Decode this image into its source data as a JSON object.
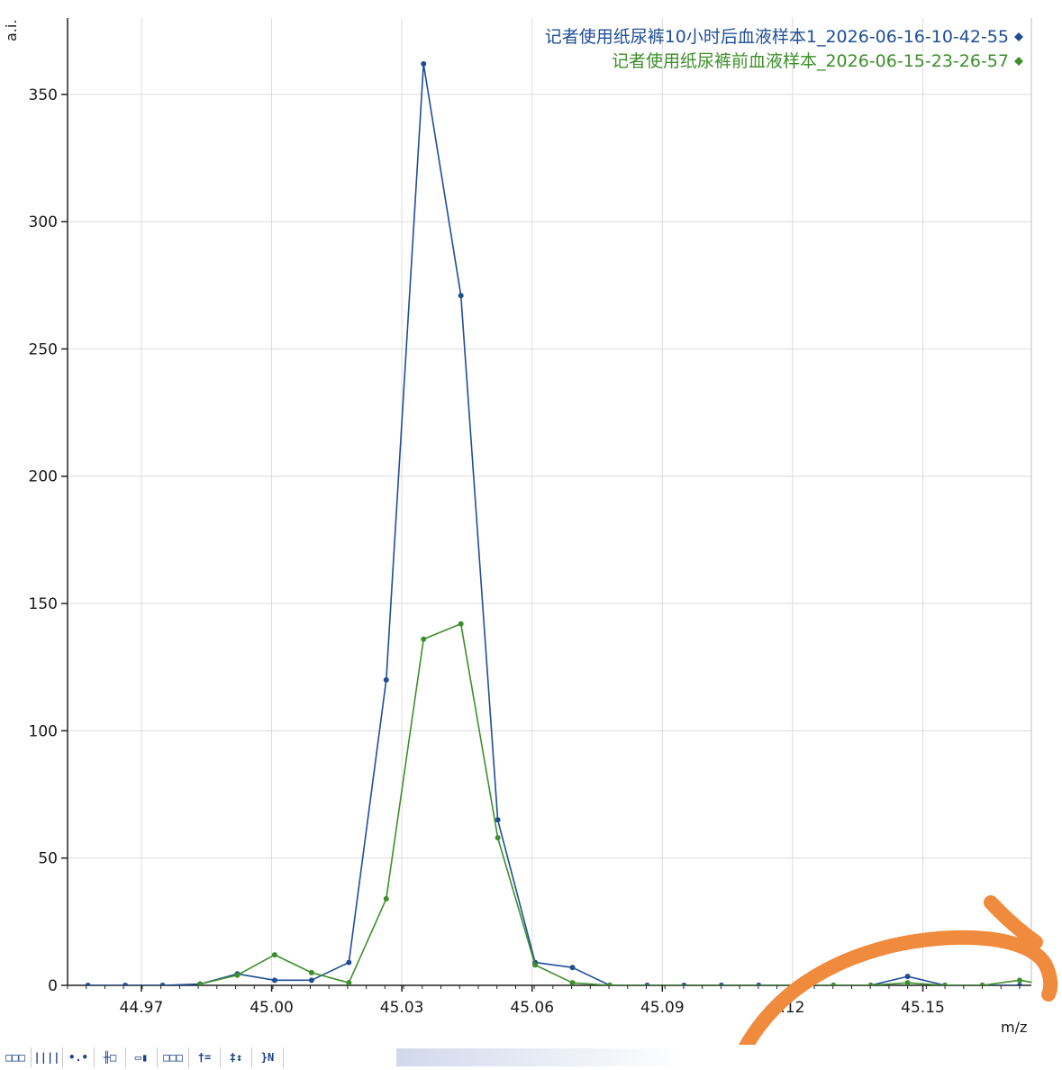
{
  "chart_data": {
    "type": "line",
    "ylabel": "a.i.",
    "xlabel": "m/z",
    "xlim": [
      44.953,
      45.175
    ],
    "ylim": [
      0,
      380
    ],
    "x_ticks": [
      44.97,
      45.0,
      45.03,
      45.06,
      45.09,
      45.12,
      45.15
    ],
    "x_tick_labels": [
      "44.97",
      "45.00",
      "45.03",
      "45.06",
      "45.09",
      ".12",
      "45.15"
    ],
    "y_ticks": [
      0,
      50,
      100,
      150,
      200,
      250,
      300,
      350
    ],
    "y_tick_labels": [
      "0",
      "50",
      "100",
      "150",
      "200",
      "250",
      "300",
      "350"
    ],
    "grid": true,
    "legend_position": "top-right",
    "series": [
      {
        "name": "记者使用纸尿裤10小时后血液样本1_2026-06-16-10-42-55",
        "color": "#1f4e96",
        "x": [
          44.9577,
          44.9663,
          44.9749,
          44.9835,
          44.9921,
          45.0007,
          45.0092,
          45.0178,
          45.0264,
          45.035,
          45.0436,
          45.0521,
          45.0607,
          45.0693,
          45.0779,
          45.0865,
          45.095,
          45.1036,
          45.1122,
          45.1208,
          45.1294,
          45.138,
          45.1465,
          45.1551,
          45.1637,
          45.1723
        ],
        "y": [
          0,
          0,
          0,
          0.5,
          4.5,
          2,
          2,
          9,
          120,
          362,
          271,
          65,
          9,
          7,
          0,
          0,
          0,
          0,
          0,
          0,
          0,
          0,
          3.5,
          0,
          0,
          0
        ]
      },
      {
        "name": "记者使用纸尿裤前血液样本_2026-06-15-23-26-57",
        "color": "#3d8f2a",
        "x": [
          44.9835,
          44.9921,
          45.0007,
          45.0092,
          45.0178,
          45.0264,
          45.035,
          45.0436,
          45.0521,
          45.0607,
          45.0693,
          45.0779,
          45.1294,
          45.138,
          45.1465,
          45.1551,
          45.1637,
          45.1723,
          45.1758
        ],
        "y": [
          0.5,
          4,
          12,
          5,
          1,
          34,
          136,
          142,
          58,
          8,
          1,
          0,
          0,
          0,
          1,
          0,
          0,
          2,
          1
        ]
      }
    ]
  },
  "toolbar": {
    "buttons": [
      {
        "label": "□□□",
        "icon": "peak-picking-icon"
      },
      {
        "label": "||||",
        "icon": "bar-spectrum-icon"
      },
      {
        "label": "•.•",
        "icon": "point-mode-icon"
      },
      {
        "label": "╫□",
        "icon": "zoom-box-icon"
      },
      {
        "label": "▭▮",
        "icon": "range-icon"
      },
      {
        "label": "□□□",
        "icon": "overlay-icon"
      },
      {
        "label": "†=",
        "icon": "cursor-icon"
      },
      {
        "label": "‡↕",
        "icon": "scale-icon"
      },
      {
        "label": "}N",
        "icon": "normalize-icon"
      }
    ]
  },
  "annotation": {
    "color": "#f08a3c"
  }
}
